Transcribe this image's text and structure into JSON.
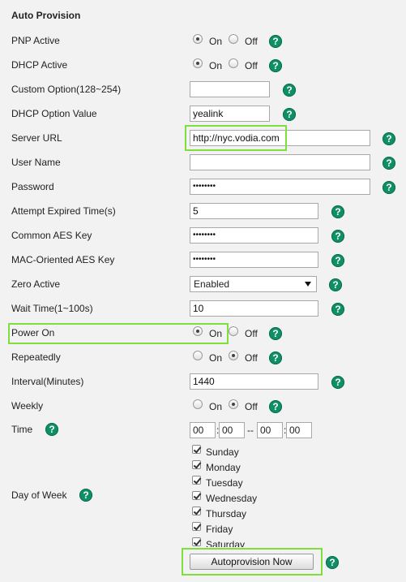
{
  "title": "Auto Provision",
  "labels": {
    "pnp_active": "PNP Active",
    "dhcp_active": "DHCP Active",
    "custom_option": "Custom Option(128~254)",
    "dhcp_option_value": "DHCP Option Value",
    "server_url": "Server URL",
    "user_name": "User Name",
    "password": "Password",
    "attempt_expired_time": "Attempt Expired Time(s)",
    "common_aes_key": "Common AES Key",
    "mac_oriented_aes_key": "MAC-Oriented AES Key",
    "zero_active": "Zero Active",
    "wait_time": "Wait Time(1~100s)",
    "power_on": "Power On",
    "repeatedly": "Repeatedly",
    "interval": "Interval(Minutes)",
    "weekly": "Weekly",
    "time": "Time",
    "day_of_week": "Day of Week"
  },
  "radio": {
    "on": "On",
    "off": "Off"
  },
  "values": {
    "custom_option": "",
    "dhcp_option_value": "yealink",
    "server_url": "http://nyc.vodia.com",
    "user_name": "",
    "password": "••••••••",
    "attempt_expired_time": "5",
    "common_aes_key": "••••••••",
    "mac_oriented_aes_key": "••••••••",
    "zero_active": "Enabled",
    "wait_time": "10",
    "interval": "1440",
    "time": {
      "h1": "00",
      "m1": "00",
      "h2": "00",
      "m2": "00"
    }
  },
  "time_separators": {
    "colon": ":",
    "dash": "--"
  },
  "days": [
    "Sunday",
    "Monday",
    "Tuesday",
    "Wednesday",
    "Thursday",
    "Friday",
    "Saturday"
  ],
  "help_glyph": "?",
  "button": {
    "autoprovision_now": "Autoprovision Now"
  },
  "colors": {
    "help": "#0e8f66",
    "highlight": "#7ee03a"
  }
}
